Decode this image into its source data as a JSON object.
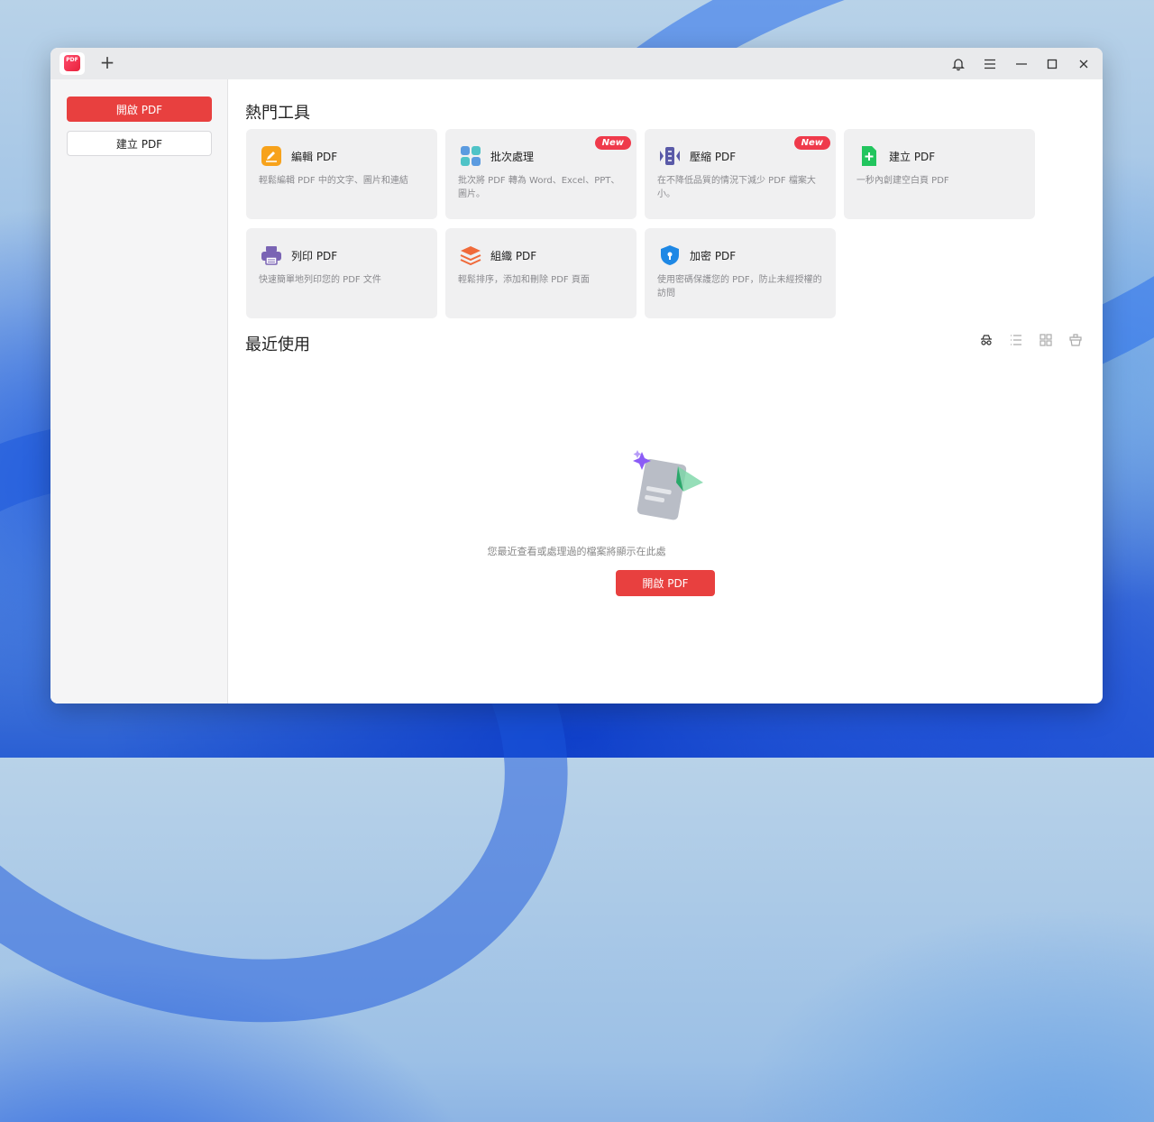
{
  "titlebar": {
    "logo_text": "PDF",
    "new_tab": "+",
    "icons": [
      "bell-icon",
      "menu-icon",
      "minimize-icon",
      "maximize-icon",
      "close-icon"
    ]
  },
  "sidebar": {
    "open_label": "開啟 PDF",
    "create_label": "建立 PDF"
  },
  "tools_section": {
    "title": "熱門工具",
    "cards": [
      {
        "title": "編輯 PDF",
        "desc": "輕鬆編輯 PDF 中的文字、圖片和連結",
        "icon": "edit-icon",
        "color": "#f7a21b"
      },
      {
        "title": "批次處理",
        "desc": "批次將 PDF 轉為 Word、Excel、PPT、圖片。",
        "icon": "batch-icon",
        "color": "#4aa8d8",
        "badge": "New"
      },
      {
        "title": "壓縮 PDF",
        "desc": "在不降低品質的情況下減少 PDF 檔案大小。",
        "icon": "compress-icon",
        "color": "#5a5aa8",
        "badge": "New"
      },
      {
        "title": "建立 PDF",
        "desc": "一秒內創建空白頁 PDF",
        "icon": "create-icon",
        "color": "#22c55e"
      },
      {
        "title": "列印 PDF",
        "desc": "快速簡單地列印您的 PDF 文件",
        "icon": "print-icon",
        "color": "#7a64b4"
      },
      {
        "title": "組織 PDF",
        "desc": "輕鬆排序，添加和刪除 PDF 頁面",
        "icon": "organize-icon",
        "color": "#f06a3a"
      },
      {
        "title": "加密 PDF",
        "desc": "使用密碼保護您的 PDF，防止未經授權的訪問",
        "icon": "encrypt-icon",
        "color": "#1e88e5"
      }
    ]
  },
  "recent_section": {
    "title": "最近使用",
    "view_icons": [
      "incognito-icon",
      "list-view-icon",
      "grid-view-icon",
      "clear-icon"
    ],
    "empty_text": "您最近查看或處理過的檔案將顯示在此處",
    "open_label": "開啟 PDF"
  }
}
